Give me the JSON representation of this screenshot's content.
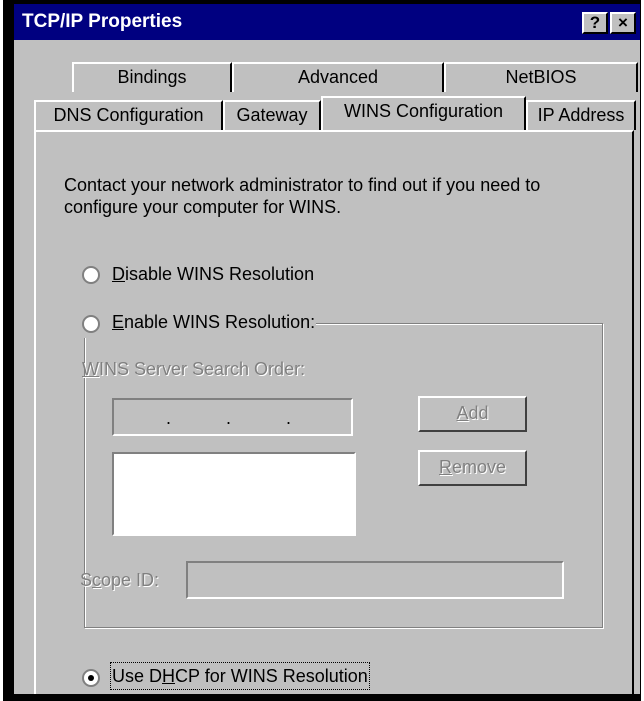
{
  "window": {
    "title": "TCP/IP Properties",
    "help_button": "?",
    "close_button": "×"
  },
  "tabs": {
    "row1": [
      {
        "label": "Bindings"
      },
      {
        "label": "Advanced"
      },
      {
        "label": "NetBIOS"
      }
    ],
    "row2": [
      {
        "label": "DNS Configuration"
      },
      {
        "label": "Gateway"
      },
      {
        "label": "WINS Configuration",
        "active": true
      },
      {
        "label": "IP Address"
      }
    ]
  },
  "wins": {
    "instructions_line1": "Contact your network administrator to find out if you need to",
    "instructions_line2": "configure your computer for WINS.",
    "disable_radio": {
      "mnemonic": "D",
      "rest": "isable WINS Resolution",
      "checked": false
    },
    "enable_radio": {
      "mnemonic": "E",
      "rest": "nable WINS Resolution:",
      "checked": false
    },
    "search_order_label": {
      "mnemonic": "W",
      "rest": "INS Server Search Order:"
    },
    "ip_separators": [
      ".",
      ".",
      "."
    ],
    "add_button": {
      "mnemonic": "A",
      "rest": "dd"
    },
    "remove_button": {
      "mnemonic": "R",
      "rest": "emove"
    },
    "scope_label": {
      "before": "S",
      "mnemonic": "c",
      "rest": "ope ID:"
    },
    "scope_value": "",
    "dhcp_radio": {
      "before": "Use D",
      "mnemonic": "H",
      "rest": "CP for WINS Resolution",
      "checked": true
    }
  },
  "colors": {
    "titlebar": "#000080",
    "face": "#c0c0c0",
    "disabled_text": "#808080"
  }
}
